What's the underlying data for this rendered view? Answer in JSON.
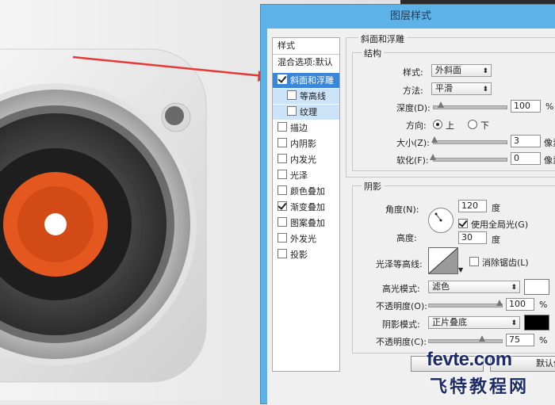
{
  "dialog": {
    "title": "图层样式"
  },
  "styles_panel": {
    "header": "样式",
    "blend_options": "混合选项:默认",
    "items": [
      {
        "label": "斜面和浮雕",
        "checked": true,
        "selected": true
      },
      {
        "label": "等高线",
        "checked": false,
        "sub": true
      },
      {
        "label": "纹理",
        "checked": false,
        "sub": true
      },
      {
        "label": "描边",
        "checked": false
      },
      {
        "label": "内阴影",
        "checked": false
      },
      {
        "label": "内发光",
        "checked": false
      },
      {
        "label": "光泽",
        "checked": false
      },
      {
        "label": "颜色叠加",
        "checked": false
      },
      {
        "label": "渐变叠加",
        "checked": true
      },
      {
        "label": "图案叠加",
        "checked": false
      },
      {
        "label": "外发光",
        "checked": false
      },
      {
        "label": "投影",
        "checked": false
      }
    ]
  },
  "bevel": {
    "section_title": "斜面和浮雕",
    "structure_title": "结构",
    "style_label": "样式:",
    "style_value": "外斜面",
    "method_label": "方法:",
    "method_value": "平滑",
    "depth_label": "深度(D):",
    "depth_value": "100",
    "depth_unit": "%",
    "direction_label": "方向:",
    "direction_up": "上",
    "direction_down": "下",
    "size_label": "大小(Z):",
    "size_value": "3",
    "size_unit": "像素",
    "soften_label": "软化(F):",
    "soften_value": "0",
    "soften_unit": "像素"
  },
  "shading": {
    "section_title": "阴影",
    "angle_label": "角度(N):",
    "angle_value": "120",
    "angle_unit": "度",
    "global_light_label": "使用全局光(G)",
    "altitude_label": "高度:",
    "altitude_value": "30",
    "altitude_unit": "度",
    "gloss_contour_label": "光泽等高线:",
    "antialias_label": "消除锯齿(L)",
    "highlight_mode_label": "高光模式:",
    "highlight_mode_value": "滤色",
    "highlight_color": "#ffffff",
    "highlight_opacity_label": "不透明度(O):",
    "highlight_opacity_value": "100",
    "shadow_mode_label": "阴影模式:",
    "shadow_mode_value": "正片叠底",
    "shadow_color": "#000000",
    "shadow_opacity_label": "不透明度(C):",
    "shadow_opacity_value": "75",
    "percent": "%"
  },
  "buttons": {
    "set_default_tail": "默认值"
  },
  "watermark": {
    "line1": "fevte.com",
    "line2": "飞特教程网"
  },
  "colors": {
    "dialog_frame": "#5db3e8",
    "selection": "#3a86d8",
    "vinyl_label": "#e4571f",
    "arrow": "#e53935"
  }
}
